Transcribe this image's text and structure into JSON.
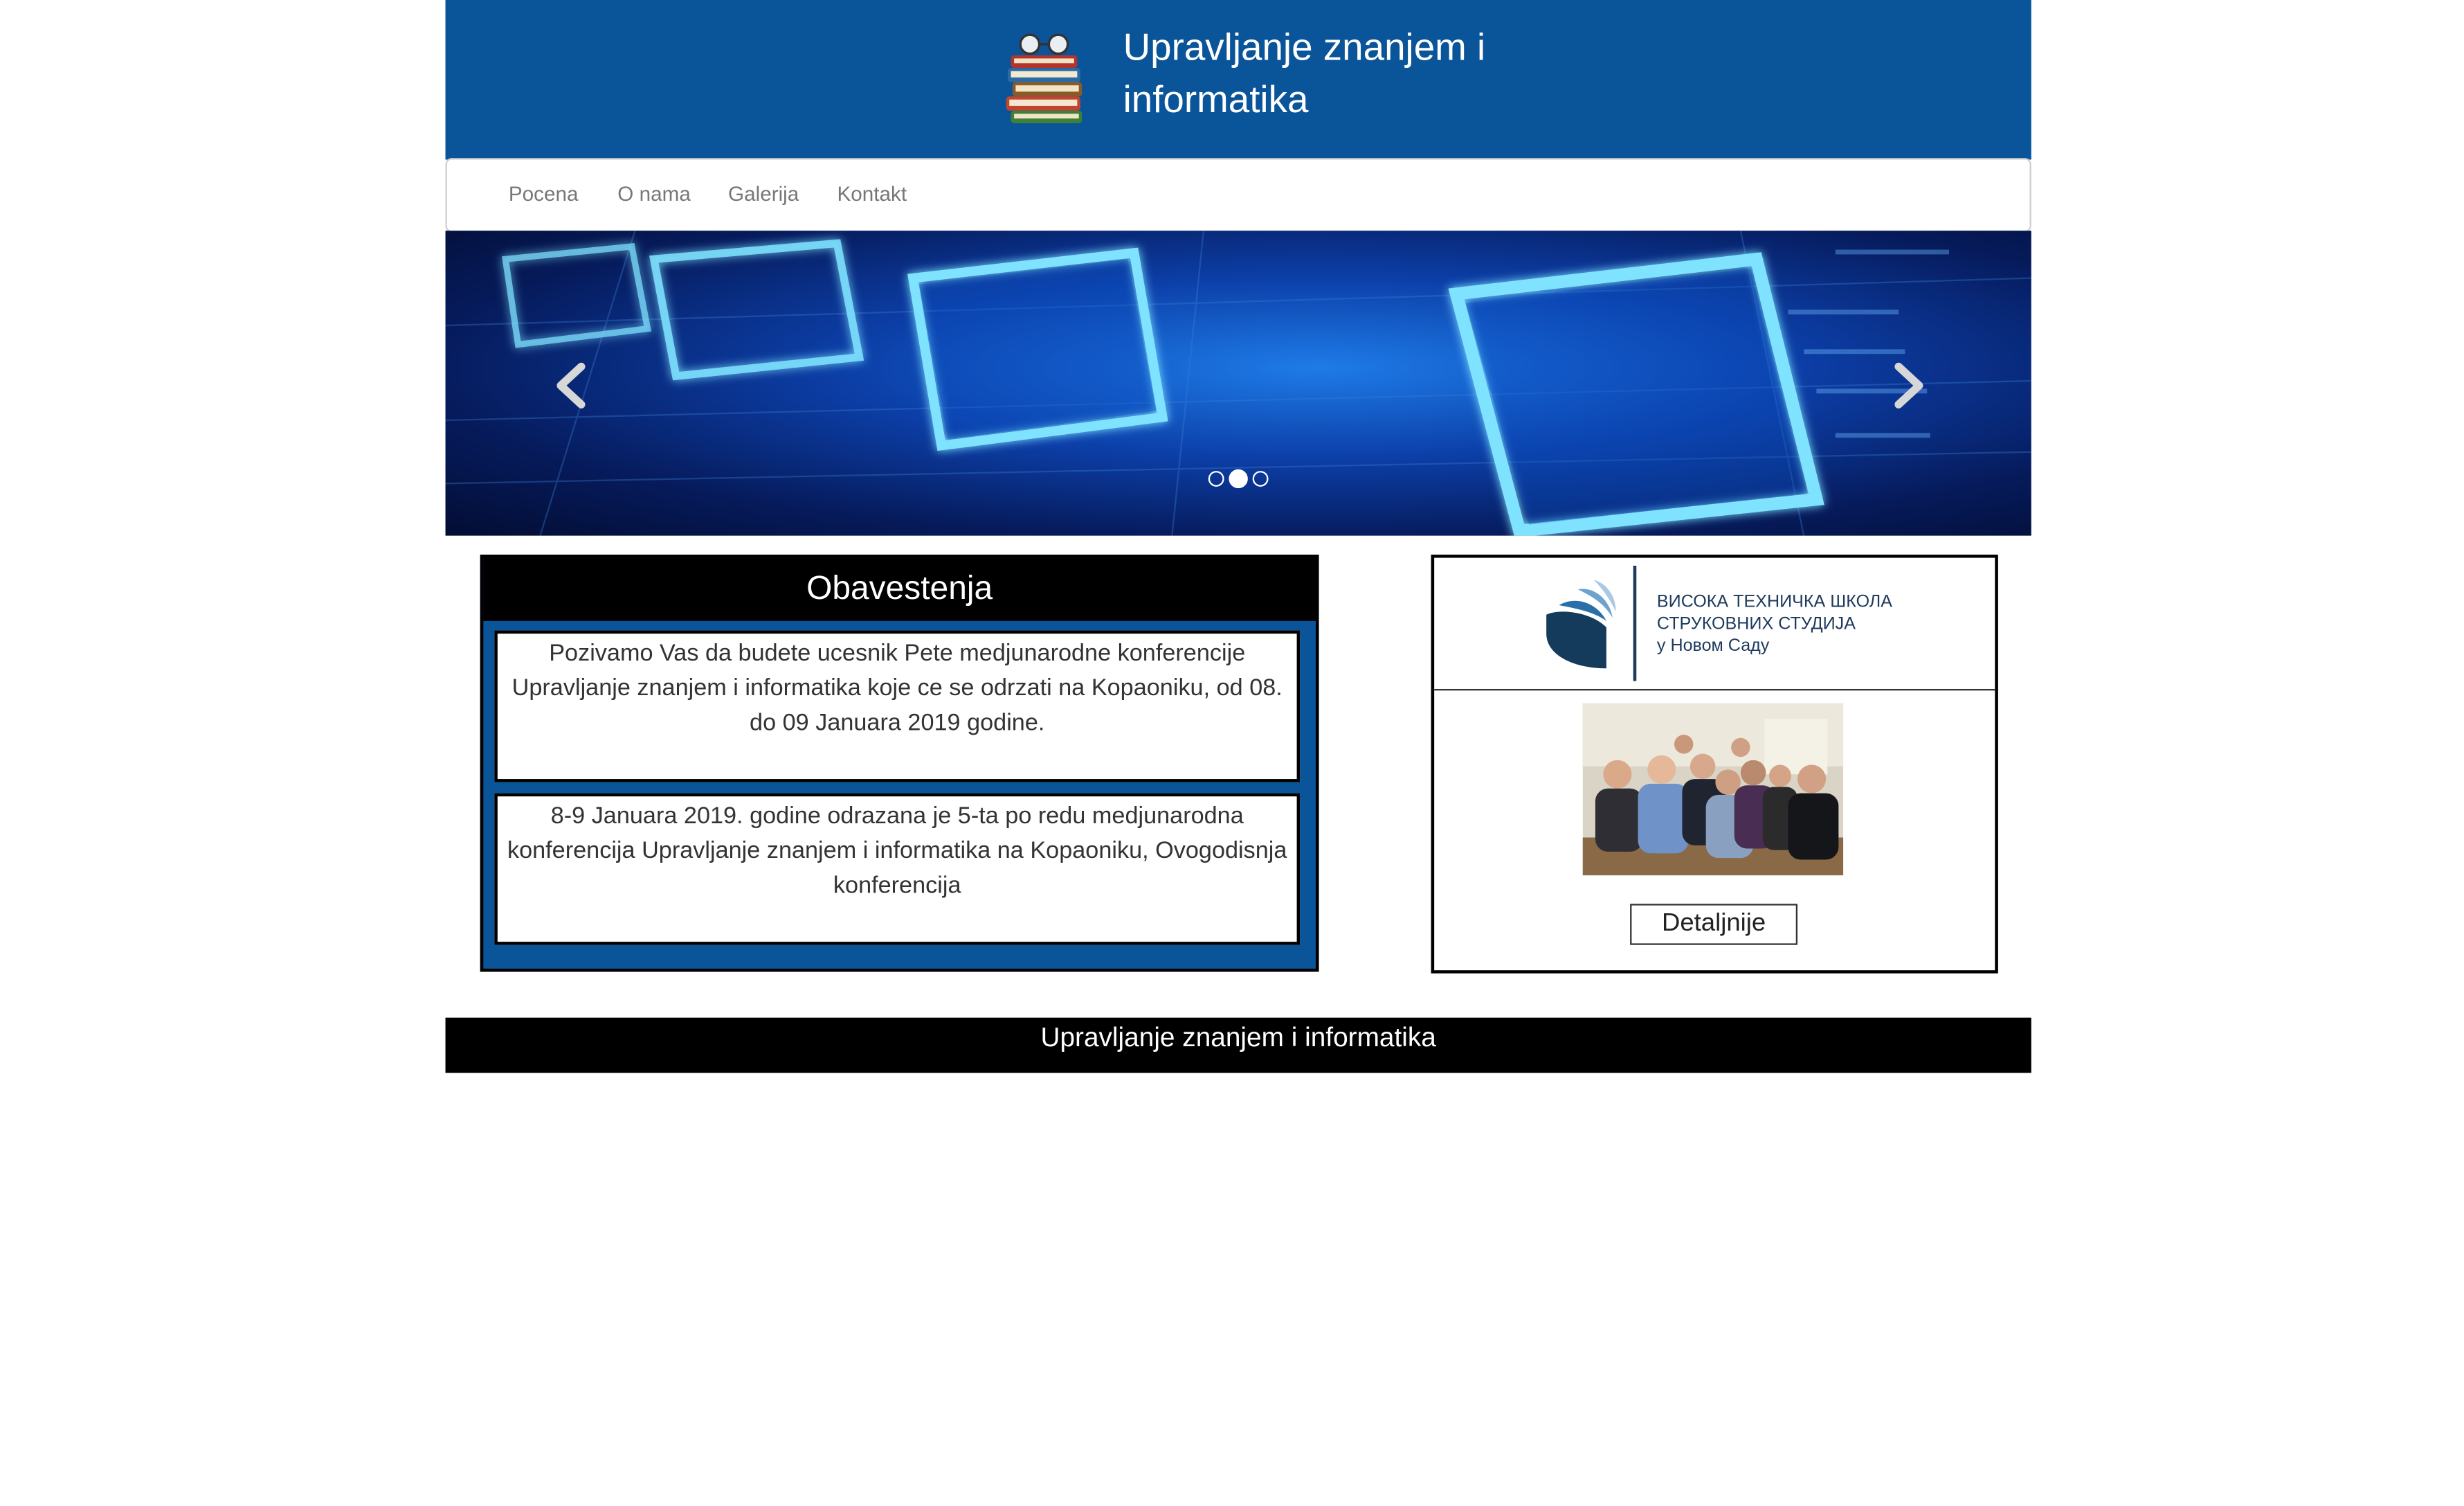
{
  "header": {
    "title": "Upravljanje znanjem i informatika",
    "logo_icon": "book-stack-with-glasses"
  },
  "nav": {
    "items": [
      {
        "label": "Pocena"
      },
      {
        "label": "O nama"
      },
      {
        "label": "Galerija"
      },
      {
        "label": "Kontakt"
      }
    ]
  },
  "carousel": {
    "prev_icon": "chevron-left-icon",
    "next_icon": "chevron-right-icon",
    "slide_count": 3,
    "active_slide": 2
  },
  "notices": {
    "heading": "Obavestenja",
    "items": [
      {
        "text": "Pozivamo Vas da budete ucesnik Pete medjunarodne konferencije Upravljanje znanjem i informatika koje ce se odrzati na Kopaoniku, od 08. do 09 Januara 2019 godine."
      },
      {
        "text": "8-9 Januara 2019. godine odrazana je 5-ta po redu medjunarodna konferencija Upravljanje znanjem i informatika na Kopaoniku, Ovogodisnja konferencija"
      }
    ]
  },
  "school": {
    "name_line1": "ВИСОКА ТЕХНИЧКА ШКОЛА",
    "name_line2": "СТРУКОВНИХ СТУДИЈА",
    "name_line3": "у Новом Саду",
    "details_label": "Detaljnije"
  },
  "footer": {
    "text": "Upravljanje znanjem i informatika"
  },
  "colors": {
    "header_blue": "#0a5499",
    "black": "#000000",
    "school_navy": "#1d3a5c"
  }
}
